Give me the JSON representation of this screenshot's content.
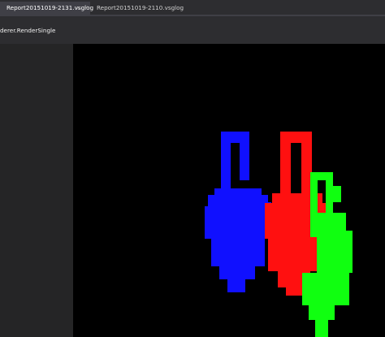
{
  "tabs": [
    {
      "label": "Report20151019-2131.vsglog",
      "active": true
    },
    {
      "label": "Report20151019-2110.vsglog",
      "active": false
    }
  ],
  "toolbar": {
    "event_label": "derer.RenderSingle"
  },
  "colors": {
    "background": "#2d2d30",
    "active_tab": "#3f3f46",
    "viewport": "#000000",
    "figure_blue": "#1010ff",
    "figure_red": "#ff1010",
    "figure_green": "#10ff10"
  },
  "icons": {
    "tab_pin": "pin-icon",
    "tab_close": "close-icon"
  }
}
